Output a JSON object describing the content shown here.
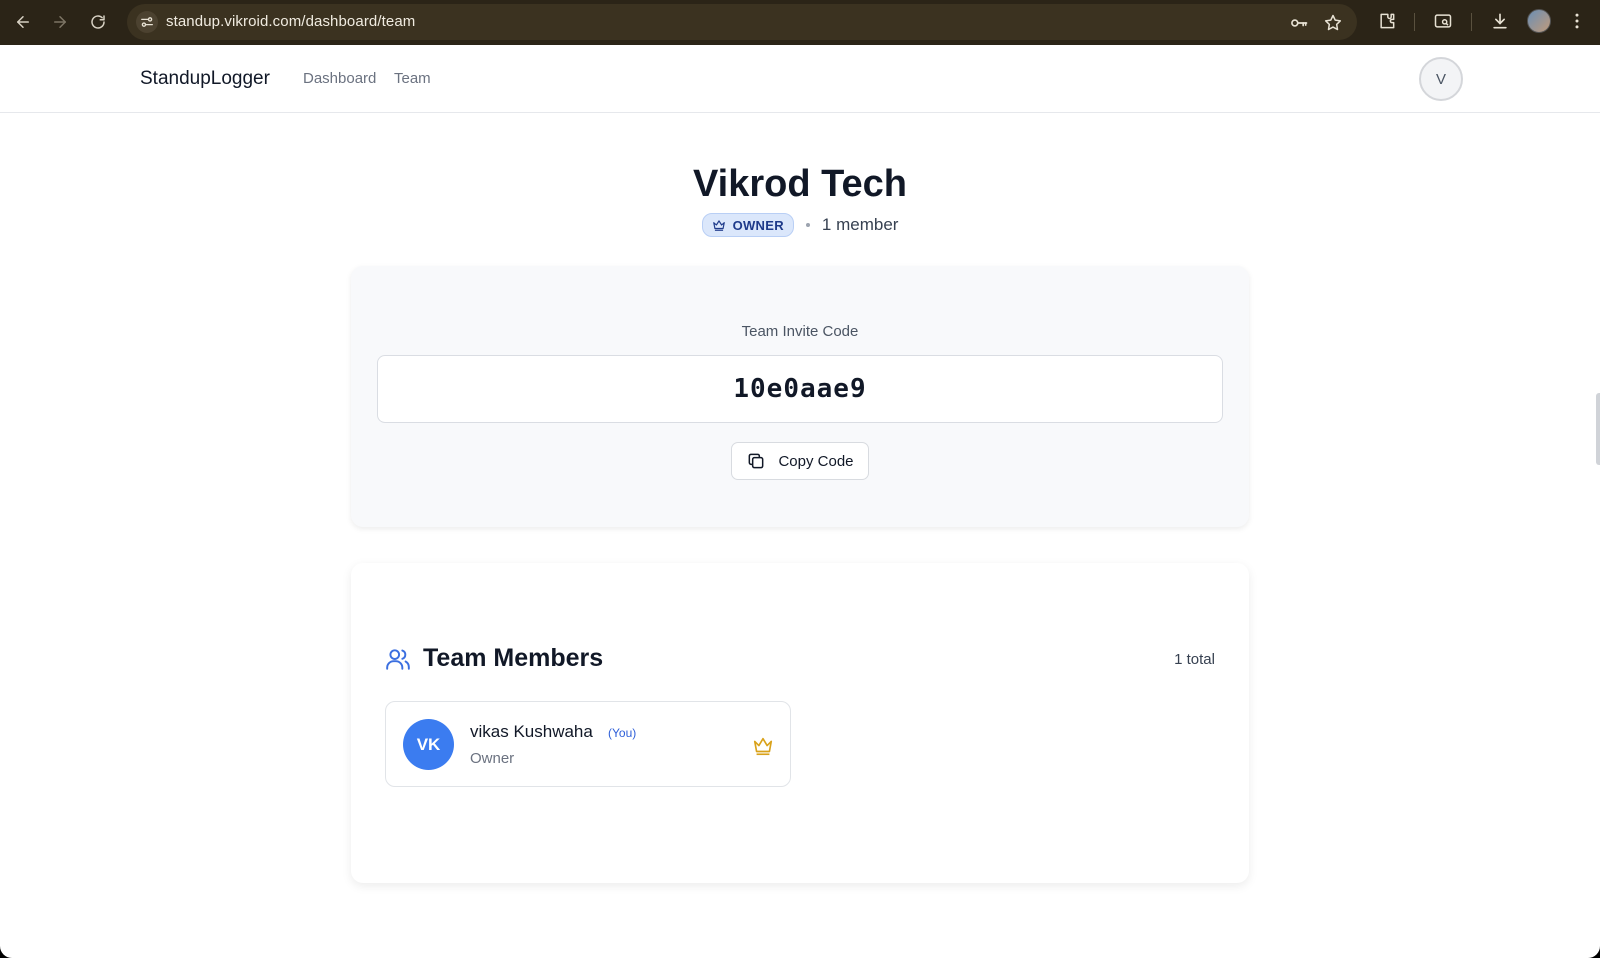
{
  "browser": {
    "url": "standup.vikroid.com/dashboard/team"
  },
  "nav": {
    "brand": "StandupLogger",
    "links": [
      "Dashboard",
      "Team"
    ],
    "avatar_initial": "V"
  },
  "team": {
    "name": "Vikrod Tech",
    "role_badge": "OWNER",
    "member_count": "1 member"
  },
  "invite": {
    "label": "Team Invite Code",
    "code": "10e0aae9",
    "copy_label": "Copy Code"
  },
  "members": {
    "title": "Team Members",
    "total": "1 total",
    "items": [
      {
        "initials": "VK",
        "name": "vikas Kushwaha",
        "you_tag": "(You)",
        "role": "Owner"
      }
    ]
  },
  "colors": {
    "accent": "#3b7cf0",
    "badge_bg": "#dbe7fb",
    "crown": "#d9a21b"
  }
}
